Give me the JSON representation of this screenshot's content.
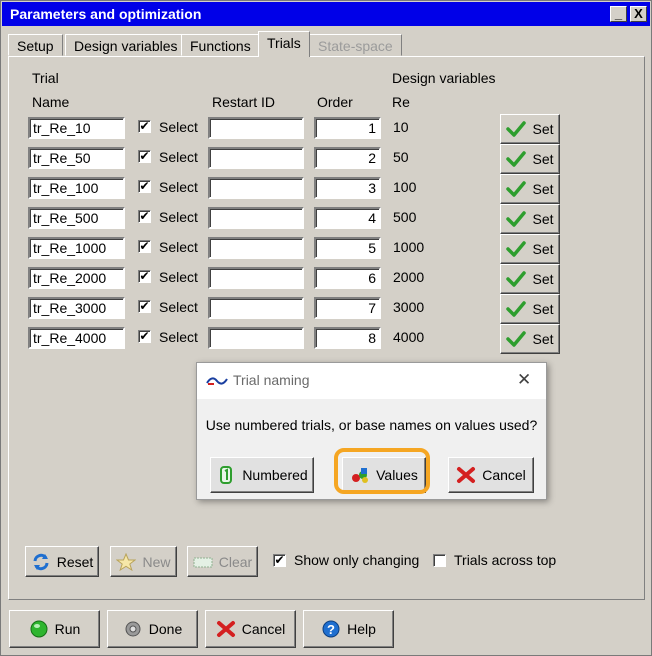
{
  "window": {
    "title": "Parameters and optimization",
    "minimize_glyph": "_",
    "close_glyph": "X"
  },
  "tabs": [
    {
      "label": "Setup"
    },
    {
      "label": "Design variables"
    },
    {
      "label": "Functions"
    },
    {
      "label": "Trials"
    },
    {
      "label": "State-space"
    }
  ],
  "headers": {
    "trial_top": "Trial",
    "trial_name": "Name",
    "restart_id": "Restart ID",
    "order": "Order",
    "design_variables": "Design variables",
    "re": "Re"
  },
  "rows": [
    {
      "name": "tr_Re_10",
      "checked": "✔",
      "select_label": "Select",
      "restart_id": "",
      "order": "1",
      "re": "10",
      "set_label": "Set"
    },
    {
      "name": "tr_Re_50",
      "checked": "✔",
      "select_label": "Select",
      "restart_id": "",
      "order": "2",
      "re": "50",
      "set_label": "Set"
    },
    {
      "name": "tr_Re_100",
      "checked": "✔",
      "select_label": "Select",
      "restart_id": "",
      "order": "3",
      "re": "100",
      "set_label": "Set"
    },
    {
      "name": "tr_Re_500",
      "checked": "✔",
      "select_label": "Select",
      "restart_id": "",
      "order": "4",
      "re": "500",
      "set_label": "Set"
    },
    {
      "name": "tr_Re_1000",
      "checked": "✔",
      "select_label": "Select",
      "restart_id": "",
      "order": "5",
      "re": "1000",
      "set_label": "Set"
    },
    {
      "name": "tr_Re_2000",
      "checked": "✔",
      "select_label": "Select",
      "restart_id": "",
      "order": "6",
      "re": "2000",
      "set_label": "Set"
    },
    {
      "name": "tr_Re_3000",
      "checked": "✔",
      "select_label": "Select",
      "restart_id": "",
      "order": "7",
      "re": "3000",
      "set_label": "Set"
    },
    {
      "name": "tr_Re_4000",
      "checked": "✔",
      "select_label": "Select",
      "restart_id": "",
      "order": "8",
      "re": "4000",
      "set_label": "Set"
    }
  ],
  "dialog": {
    "title": "Trial naming",
    "close_glyph": "✕",
    "message": "Use numbered trials, or base names on values used?",
    "numbered_label": "Numbered",
    "values_label": "Values",
    "cancel_label": "Cancel",
    "highlight_color": "#f5a623"
  },
  "toolbar": {
    "reset_label": "Reset",
    "new_label": "New",
    "clear_label": "Clear",
    "show_only_changing_label": "Show only changing",
    "show_only_changing_checked": "✔",
    "trials_across_top_label": "Trials across top",
    "trials_across_top_checked": ""
  },
  "footer": {
    "run_label": "Run",
    "done_label": "Done",
    "cancel_label": "Cancel",
    "help_label": "Help"
  },
  "colors": {
    "titlebar": "#0000e8",
    "check_green": "#2e9e2e",
    "cancel_red": "#d42020",
    "help_blue": "#1f6fd0"
  },
  "icons": {
    "set": "green-checkmark-icon",
    "reset": "refresh-arrows-icon",
    "new": "star-icon",
    "clear": "clear-icon",
    "run": "green-ball-icon",
    "done": "gear-ball-icon",
    "cancel": "red-x-icon",
    "help": "question-icon",
    "numbered": "numbered-icon",
    "values": "values-icon",
    "dialog_app": "app-logo-icon"
  }
}
